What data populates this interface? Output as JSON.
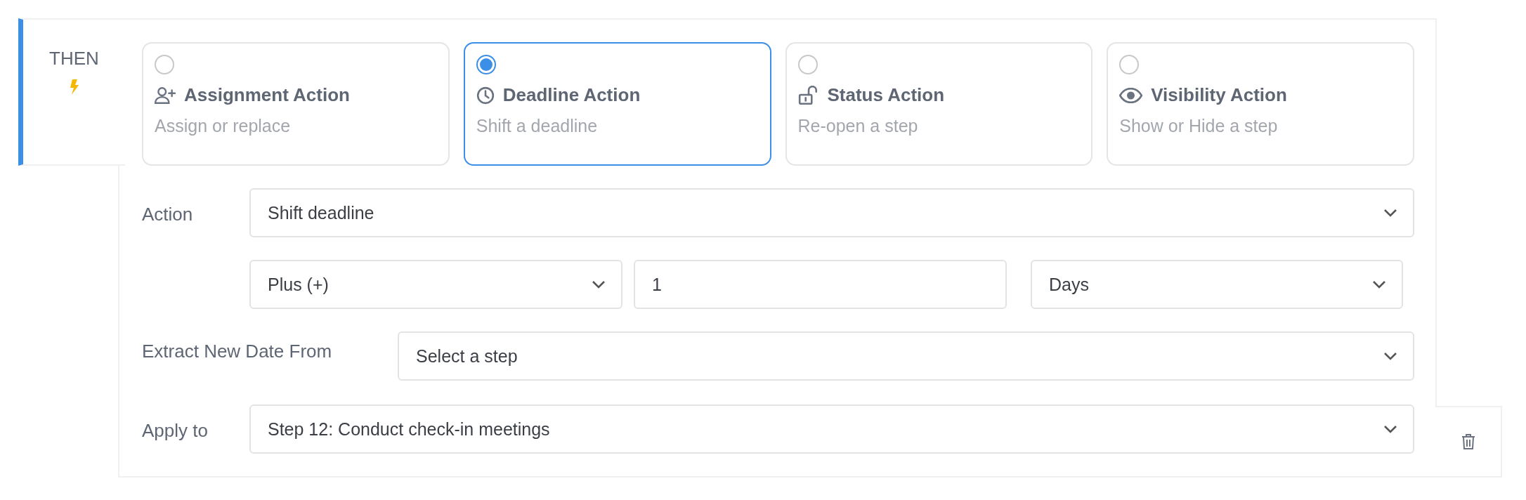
{
  "then_label": "THEN",
  "action_types": [
    {
      "kind": "assignment",
      "title": "Assignment Action",
      "description": "Assign or replace",
      "selected": false
    },
    {
      "kind": "deadline",
      "title": "Deadline Action",
      "description": "Shift a deadline",
      "selected": true
    },
    {
      "kind": "status",
      "title": "Status Action",
      "description": "Re-open a step",
      "selected": false
    },
    {
      "kind": "visibility",
      "title": "Visibility Action",
      "description": "Show or Hide a step",
      "selected": false
    }
  ],
  "action": {
    "label": "Action",
    "value": "Shift deadline"
  },
  "shift": {
    "operator": "Plus (+)",
    "amount": "1",
    "unit": "Days"
  },
  "extract_from": {
    "label": "Extract New Date From",
    "value": "Select a step"
  },
  "apply_to": {
    "label": "Apply to",
    "value": "Step 12: Conduct check-in meetings"
  }
}
